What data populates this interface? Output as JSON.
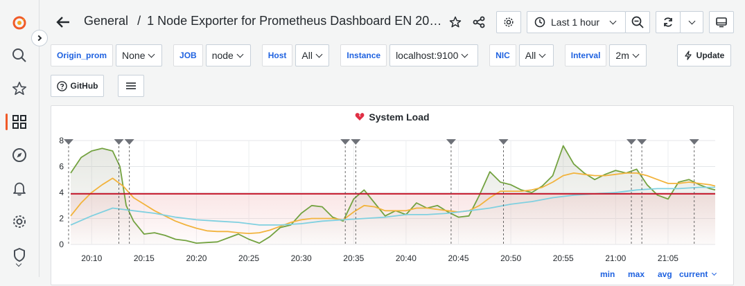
{
  "header": {
    "folder": "General",
    "separator": "/",
    "title": "1 Node Exporter for Prometheus Dashboard EN 20201..."
  },
  "time_picker": {
    "label": "Last 1 hour"
  },
  "variables": [
    {
      "label": "Origin_prom",
      "value": "None"
    },
    {
      "label": "JOB",
      "value": "node"
    },
    {
      "label": "Host",
      "value": "All"
    },
    {
      "label": "Instance",
      "value": "localhost:9100"
    },
    {
      "label": "NIC",
      "value": "All"
    },
    {
      "label": "Interval",
      "value": "2m"
    }
  ],
  "buttons": {
    "update": "Update",
    "github": "GitHub"
  },
  "panel": {
    "title": "System Load",
    "legend_headers": [
      "min",
      "max",
      "avg",
      "current"
    ]
  },
  "colors": {
    "green": "#73a240",
    "yellow": "#f2b33c",
    "blue": "#7fd0e0",
    "threshold": "#c4162a",
    "accent": "#f05a28",
    "link": "#1f62e0"
  },
  "chart_data": {
    "type": "line",
    "ylim": [
      0,
      8
    ],
    "yticks": [
      "0",
      "2",
      "4",
      "6",
      "8"
    ],
    "xticks": [
      "20:10",
      "20:15",
      "20:20",
      "20:25",
      "20:30",
      "20:35",
      "20:40",
      "20:45",
      "20:50",
      "20:55",
      "21:00",
      "21:05"
    ],
    "xlim_minutes": [
      8,
      69.5
    ],
    "threshold": 3.9,
    "annotations_minutes": [
      7.8,
      12.6,
      13.6,
      34.2,
      35.2,
      44.3,
      49.3,
      61.5,
      62.5,
      67.5
    ],
    "series": [
      {
        "color": "green",
        "x": [
          8,
          9,
          10,
          11,
          12,
          12.7,
          13.3,
          14,
          15,
          16,
          17,
          18,
          19,
          20,
          21,
          22,
          23,
          24,
          25,
          26,
          27,
          28,
          29,
          30,
          31,
          32,
          33,
          34,
          35,
          36,
          37,
          38,
          39,
          40,
          41,
          42,
          43,
          44,
          45,
          46,
          47,
          48,
          49,
          50,
          51,
          52,
          53,
          54,
          55,
          56,
          57,
          58,
          59,
          60,
          61,
          62,
          63,
          64,
          65,
          66,
          67,
          68,
          69,
          69.5
        ],
        "values": [
          5.5,
          6.7,
          7.2,
          7.4,
          7.2,
          6.0,
          3.0,
          1.8,
          0.8,
          0.9,
          0.7,
          0.4,
          0.3,
          0.1,
          0.15,
          0.2,
          0.5,
          0.8,
          0.4,
          0.1,
          0.6,
          1.3,
          1.5,
          2.4,
          3.0,
          2.9,
          2.1,
          1.8,
          3.5,
          4.2,
          3.2,
          2.2,
          2.6,
          2.3,
          3.2,
          2.8,
          3.0,
          2.5,
          2.1,
          2.2,
          3.8,
          5.6,
          4.8,
          4.6,
          4.2,
          4.0,
          4.5,
          5.3,
          7.6,
          6.2,
          5.5,
          5.0,
          5.4,
          5.7,
          5.5,
          5.8,
          4.6,
          3.8,
          3.5,
          4.8,
          5.0,
          4.6,
          4.3,
          4.2
        ]
      },
      {
        "color": "yellow",
        "x": [
          8,
          9,
          10,
          11,
          12,
          13,
          14,
          15,
          16,
          17,
          18,
          19,
          20,
          21,
          22,
          23,
          24,
          25,
          26,
          27,
          28,
          29,
          30,
          31,
          32,
          33,
          34,
          35,
          36,
          37,
          38,
          39,
          40,
          41,
          42,
          43,
          44,
          45,
          46,
          47,
          48,
          49,
          50,
          51,
          52,
          53,
          54,
          55,
          56,
          57,
          58,
          59,
          60,
          61,
          62,
          63,
          64,
          65,
          66,
          67,
          68,
          69,
          69.5
        ],
        "values": [
          2.2,
          3.2,
          4.0,
          4.6,
          5.1,
          4.5,
          3.6,
          3.1,
          2.6,
          2.2,
          1.8,
          1.5,
          1.25,
          1.05,
          1.0,
          1.0,
          0.9,
          0.85,
          0.9,
          1.1,
          1.4,
          1.7,
          1.9,
          2.0,
          2.0,
          2.0,
          1.9,
          2.5,
          3.0,
          2.9,
          2.6,
          2.6,
          2.6,
          2.8,
          2.8,
          2.7,
          2.6,
          2.5,
          2.6,
          3.0,
          3.6,
          4.1,
          4.1,
          4.1,
          4.2,
          4.4,
          4.8,
          5.3,
          5.5,
          5.4,
          5.3,
          5.3,
          5.4,
          5.5,
          5.5,
          5.3,
          5.0,
          4.7,
          4.7,
          4.8,
          4.7,
          4.6,
          4.5
        ]
      },
      {
        "color": "blue",
        "x": [
          8,
          10,
          12,
          14,
          16,
          18,
          20,
          22,
          24,
          26,
          28,
          30,
          32,
          34,
          36,
          38,
          40,
          42,
          44,
          46,
          48,
          50,
          52,
          54,
          56,
          58,
          60,
          62,
          64,
          66,
          68,
          69.5
        ],
        "values": [
          1.5,
          2.2,
          2.8,
          2.6,
          2.4,
          2.1,
          1.9,
          1.8,
          1.7,
          1.5,
          1.5,
          1.6,
          1.8,
          1.9,
          2.0,
          2.1,
          2.3,
          2.3,
          2.4,
          2.6,
          2.8,
          3.1,
          3.3,
          3.6,
          3.8,
          3.9,
          4.0,
          4.2,
          4.3,
          4.3,
          4.4,
          4.4
        ]
      }
    ]
  }
}
